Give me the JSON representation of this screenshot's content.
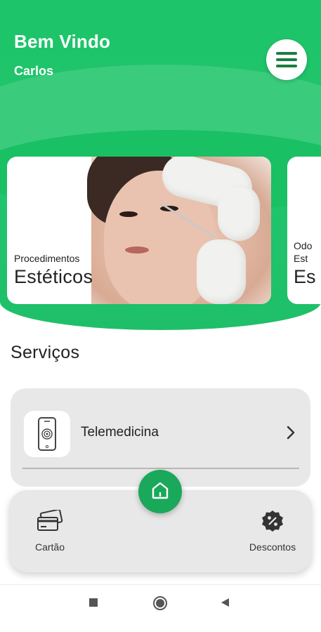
{
  "header": {
    "welcome": "Bem Vindo",
    "username": "Carlos"
  },
  "icons": {
    "menu": "hamburger-menu-icon",
    "home": "home-icon",
    "card": "credit-cards-icon",
    "discount": "discount-badge-icon",
    "telemedicine": "smartphone-fingerprint-icon",
    "chevron": "chevron-right-icon"
  },
  "carousel": {
    "cards": [
      {
        "small": "Procedimentos",
        "big": "Estéticos"
      },
      {
        "small": "Odo\nEst",
        "big": "Es"
      }
    ]
  },
  "services": {
    "title": "Serviços",
    "items": [
      {
        "label": "Telemedicina"
      }
    ]
  },
  "bottom_nav": {
    "cartao": "Cartão",
    "descontos": "Descontos"
  },
  "colors": {
    "primary_green": "#1ec46a",
    "dark_green": "#1a7e3f",
    "home_green": "#1aa85a",
    "card_gray": "#e8e8e8"
  }
}
